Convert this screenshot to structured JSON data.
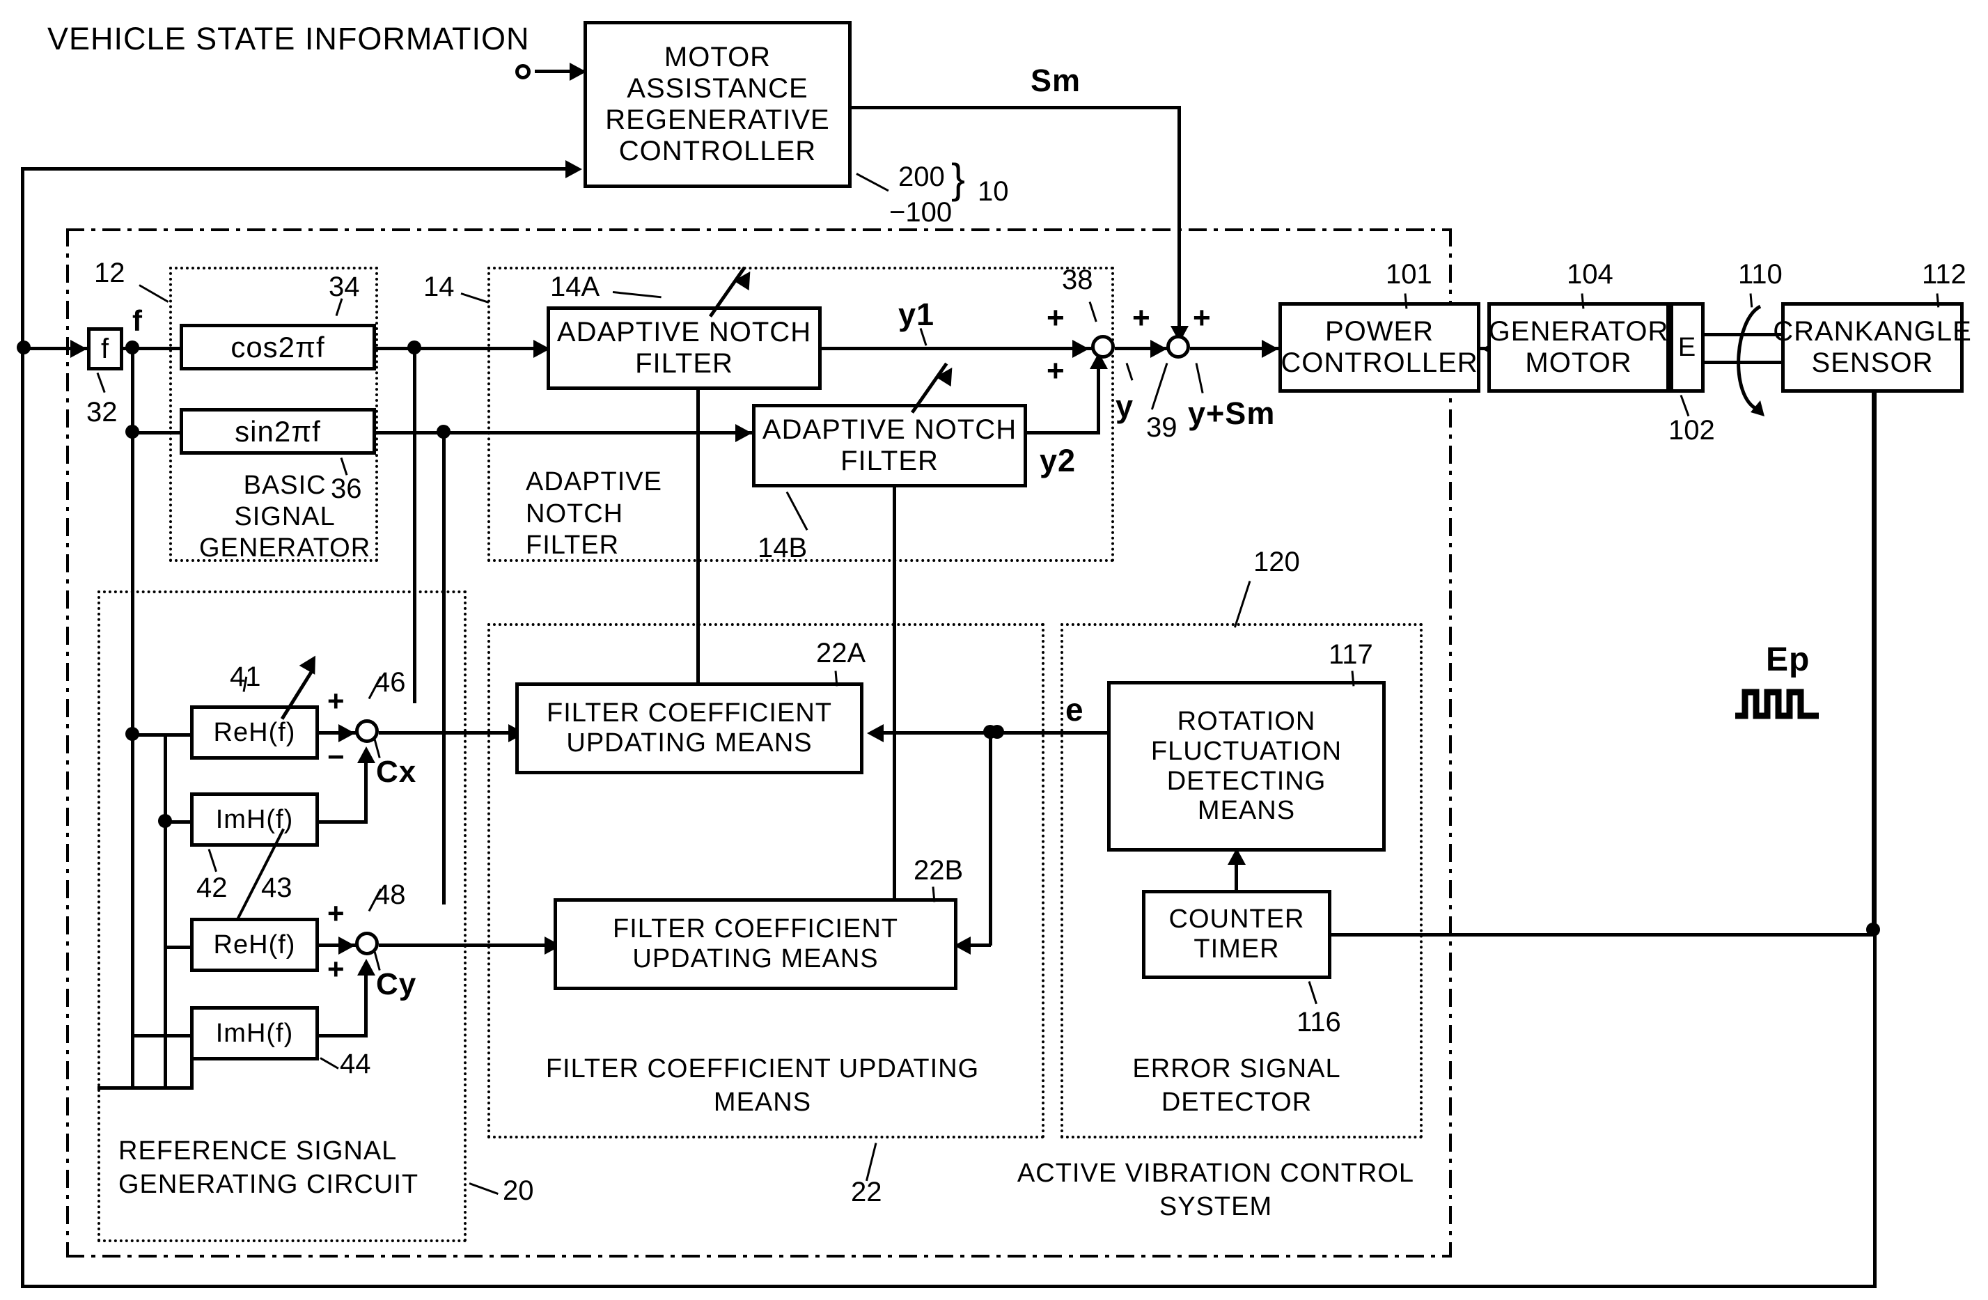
{
  "figure": {
    "title": "Active vibration control system block diagram",
    "input_label": "VEHICLE STATE INFORMATION"
  },
  "blocks": {
    "motor_controller": "MOTOR\nASSISTANCE\nREGENERATIVE\nCONTROLLER",
    "motor_controller_lines": [
      "MOTOR",
      "ASSISTANCE",
      "REGENERATIVE",
      "CONTROLLER"
    ],
    "f_block": "f",
    "cos_block": "cos2πf",
    "sin_block": "sin2πf",
    "anf_a": "ADAPTIVE NOTCH\nFILTER",
    "anf_a_lines": [
      "ADAPTIVE NOTCH",
      "FILTER"
    ],
    "anf_b": "ADAPTIVE NOTCH\nFILTER",
    "anf_b_lines": [
      "ADAPTIVE NOTCH",
      "FILTER"
    ],
    "power_controller_lines": [
      "POWER",
      "CONTROLLER"
    ],
    "generator_motor_lines": [
      "GENERATOR",
      "MOTOR"
    ],
    "encoder": "E",
    "crankangle_sensor_lines": [
      "CRANKANGLE",
      "SENSOR"
    ],
    "reh_1": "ReH(f)",
    "imh_1": "ImH(f)",
    "reh_2": "ReH(f)",
    "imh_2": "ImH(f)",
    "fcum_a_lines": [
      "FILTER COEFFICIENT",
      "UPDATING MEANS"
    ],
    "fcum_b_lines": [
      "FILTER COEFFICIENT",
      "UPDATING MEANS"
    ],
    "rotation_fluct_lines": [
      "ROTATION",
      "FLUCTUATION",
      "DETECTING",
      "MEANS"
    ],
    "counter_timer_lines": [
      "COUNTER",
      "TIMER"
    ]
  },
  "group_labels": {
    "basic_signal_generator_lines": [
      "BASIC",
      "SIGNAL",
      "GENERATOR"
    ],
    "adaptive_notch_filter_lines": [
      "ADAPTIVE",
      "NOTCH",
      "FILTER"
    ],
    "reference_signal_circuit_lines": [
      "REFERENCE SIGNAL",
      "GENERATING CIRCUIT"
    ],
    "filter_coefficient_updating_lines": [
      "FILTER COEFFICIENT UPDATING",
      "MEANS"
    ],
    "error_signal_detector_lines": [
      "ERROR SIGNAL",
      "DETECTOR"
    ],
    "active_vibration_control_lines": [
      "ACTIVE VIBRATION CONTROL",
      "SYSTEM"
    ]
  },
  "signals": {
    "sm": "Sm",
    "f": "f",
    "y1": "y1",
    "y2": "y2",
    "y": "y",
    "y_plus_sm": "y+Sm",
    "e": "e",
    "cx": "Cx",
    "cy": "Cy",
    "ep": "Ep",
    "plus": "+",
    "minus": "−"
  },
  "ref_numerals": {
    "n10": "10",
    "n12": "12",
    "n14": "14",
    "n14A": "14A",
    "n14B": "14B",
    "n20": "20",
    "n22": "22",
    "n22A": "22A",
    "n22B": "22B",
    "n32": "32",
    "n34": "34",
    "n36": "36",
    "n38": "38",
    "n39": "39",
    "n41": "41",
    "n42": "42",
    "n43": "43",
    "n44": "44",
    "n46": "46",
    "n48": "48",
    "n100": "−100",
    "n101": "101",
    "n102": "102",
    "n104": "104",
    "n110": "110",
    "n112": "112",
    "n116": "116",
    "n117": "117",
    "n120": "120",
    "n200": "200"
  },
  "colors": {
    "ink": "#000000",
    "paper": "#ffffff"
  }
}
